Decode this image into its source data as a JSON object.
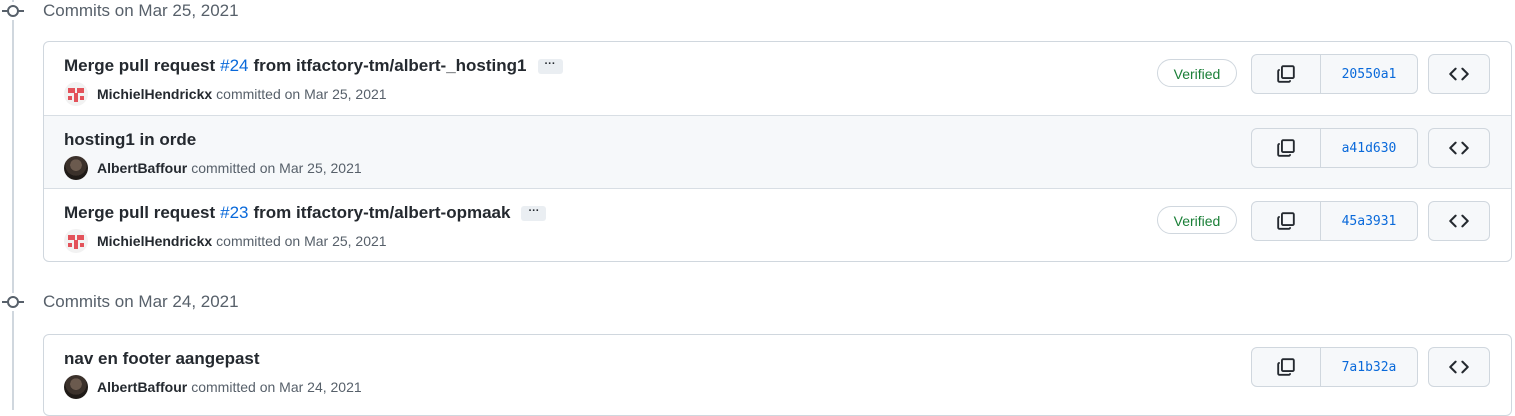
{
  "groups": [
    {
      "title": "Commits on Mar 25, 2021",
      "commits": [
        {
          "title_prefix": "Merge pull request",
          "pr_link": "#24",
          "title_suffix": "from itfactory-tm/albert-_hosting1",
          "ellipsis": "···",
          "author": "MichielHendrickx",
          "committed_text": "committed on Mar 25, 2021",
          "verified": "Verified",
          "sha": "20550a1"
        },
        {
          "title": "hosting1 in orde",
          "author": "AlbertBaffour",
          "committed_text": "committed on Mar 25, 2021",
          "sha": "a41d630"
        },
        {
          "title_prefix": "Merge pull request",
          "pr_link": "#23",
          "title_suffix": "from itfactory-tm/albert-opmaak",
          "ellipsis": "···",
          "author": "MichielHendrickx",
          "committed_text": "committed on Mar 25, 2021",
          "verified": "Verified",
          "sha": "45a3931"
        }
      ]
    },
    {
      "title": "Commits on Mar 24, 2021",
      "commits": [
        {
          "title": "nav en footer aangepast",
          "author": "AlbertBaffour",
          "committed_text": "committed on Mar 24, 2021",
          "sha": "7a1b32a"
        }
      ]
    }
  ],
  "icons": {
    "timeline": "git-commit-icon",
    "copy": "copy-icon",
    "browse": "code-icon",
    "avatar_identicon": "identicon-avatar",
    "avatar_photo": "user-photo-avatar"
  },
  "colors": {
    "link": "#0969da",
    "verified": "#1a7f37",
    "border": "#d0d7de",
    "muted": "#57606a",
    "row_highlight": "#f6f8fa"
  }
}
